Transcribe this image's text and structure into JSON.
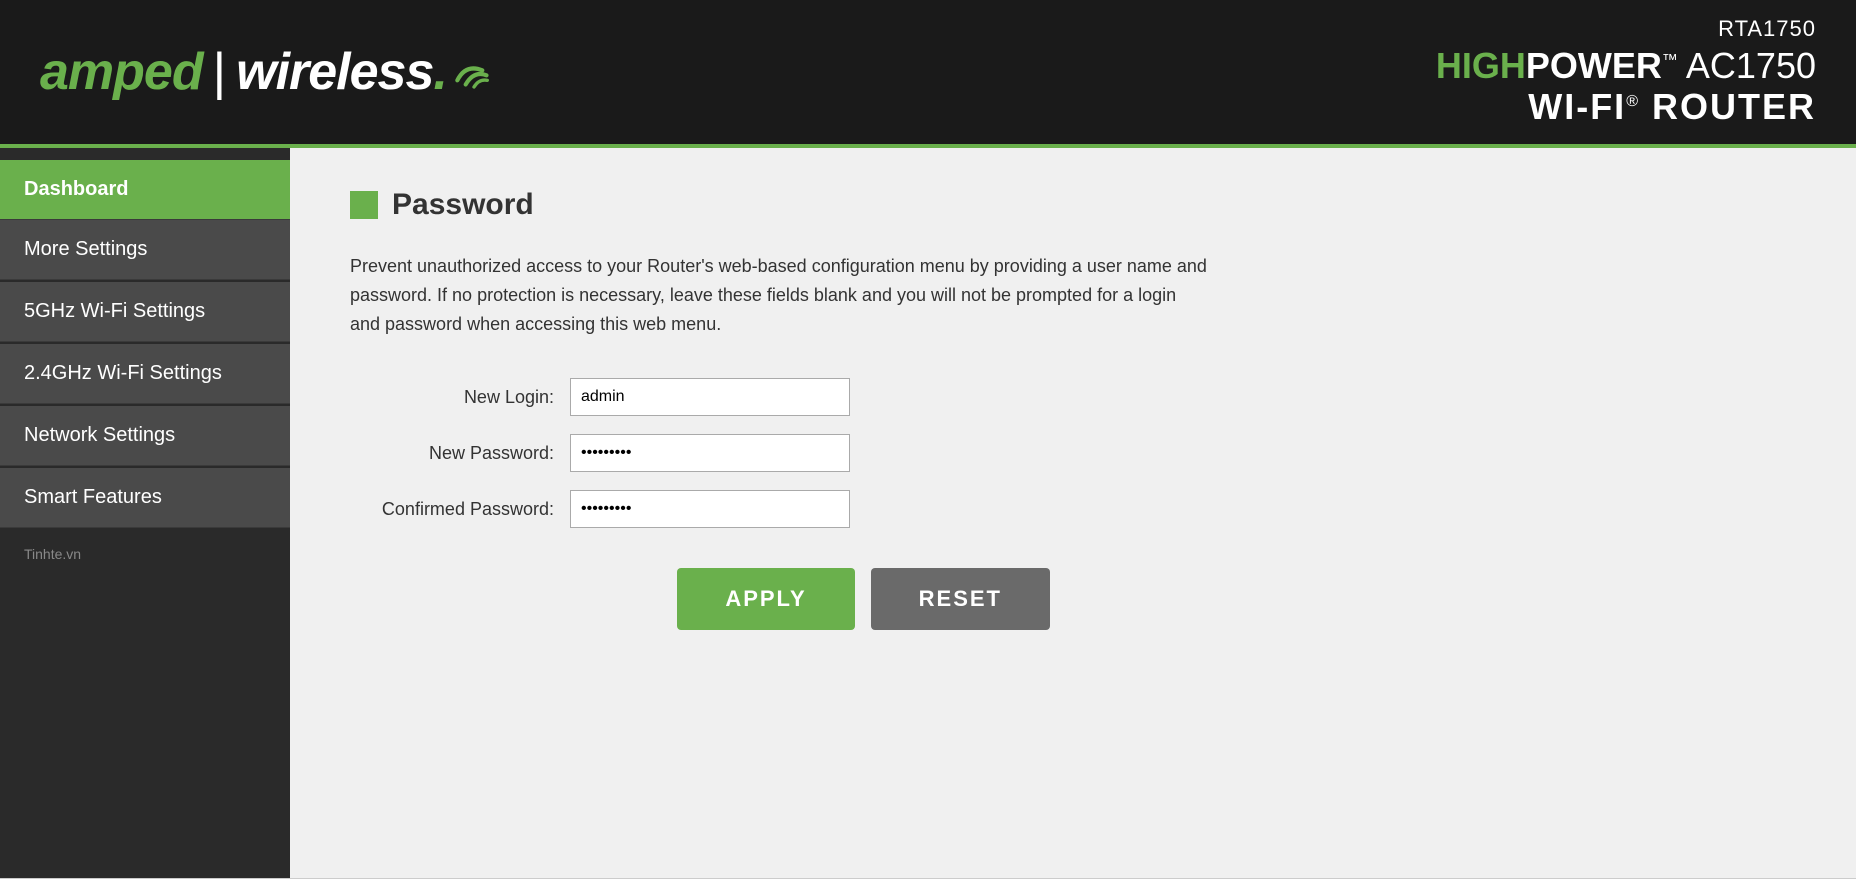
{
  "header": {
    "logo_amped": "amped",
    "logo_divider": "|",
    "logo_wireless": "wireless",
    "logo_dot": ".",
    "product_model": "RTA1750",
    "product_high": "HIGH",
    "product_power": "POWER",
    "product_tm": "™",
    "product_ac": "AC1750",
    "product_wifi": "WI-FI",
    "product_reg": "®",
    "product_router": "ROUTER"
  },
  "sidebar": {
    "items": [
      {
        "label": "Dashboard",
        "active": true
      },
      {
        "label": "More Settings",
        "active": false
      },
      {
        "label": "5GHz Wi-Fi Settings",
        "active": false
      },
      {
        "label": "2.4GHz Wi-Fi Settings",
        "active": false
      },
      {
        "label": "Network Settings",
        "active": false
      },
      {
        "label": "Smart Features",
        "active": false
      }
    ],
    "footer": "Tinhte.vn"
  },
  "main": {
    "page_title": "Password",
    "description": "Prevent unauthorized access to your Router's web-based configuration menu by providing a user name and password. If no protection is necessary, leave these fields blank and you will not be prompted for a login and password when accessing this web menu.",
    "form": {
      "new_login_label": "New Login:",
      "new_login_value": "admin",
      "new_password_label": "New Password:",
      "new_password_value": "••••••••",
      "confirmed_password_label": "Confirmed Password:",
      "confirmed_password_value": "••••••••"
    },
    "buttons": {
      "apply": "APPLY",
      "reset": "RESET"
    }
  },
  "colors": {
    "green": "#6ab04c",
    "dark_bg": "#1a1a1a",
    "sidebar_bg": "#2a2a2a",
    "sidebar_item_bg": "#4a4a4a",
    "reset_btn": "#6a6a6a"
  }
}
